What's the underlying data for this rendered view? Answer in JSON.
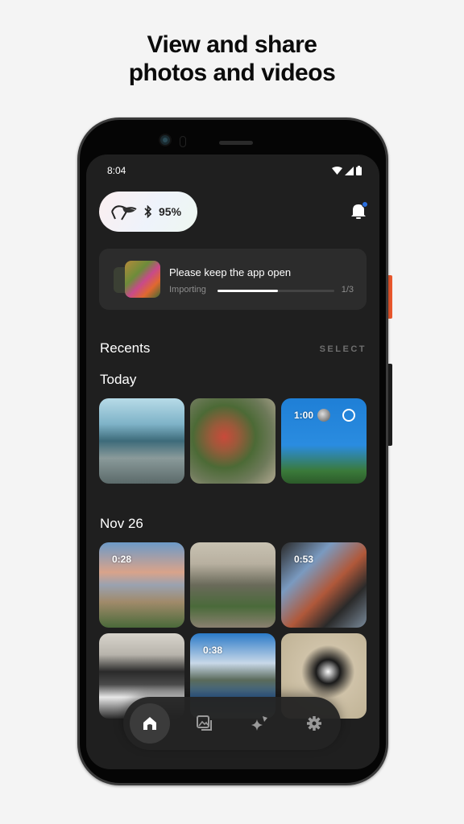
{
  "headline": {
    "line1": "View and share",
    "line2": "photos and videos"
  },
  "status_bar": {
    "time": "8:04",
    "icons": [
      "wifi-icon",
      "signal-icon",
      "battery-icon"
    ]
  },
  "device": {
    "icon": "glasses-icon",
    "connection_icon": "bluetooth-icon",
    "battery": "95%"
  },
  "notifications": {
    "icon": "bell-icon",
    "has_unread": true,
    "dot_color": "#2a6fe0"
  },
  "import": {
    "title": "Please keep the app open",
    "status": "Importing",
    "progress_percent": 52,
    "count": "1/3"
  },
  "recents": {
    "title": "Recents",
    "select_label": "SELECT"
  },
  "sections": [
    {
      "label": "Today",
      "items": [
        {
          "type": "photo",
          "description": "beach with person holding hand"
        },
        {
          "type": "photo",
          "description": "flowers arrangement"
        },
        {
          "type": "video",
          "duration": "1:00",
          "processing": true,
          "description": "hands reaching for ball against sky"
        }
      ]
    },
    {
      "label": "Nov 26",
      "items": [
        {
          "type": "video",
          "duration": "0:28",
          "description": "hot air balloons over landscape"
        },
        {
          "type": "photo",
          "description": "mirror selfie in plant-filled room"
        },
        {
          "type": "video",
          "duration": "0:53",
          "description": "window looking at brick buildings"
        },
        {
          "type": "photo",
          "description": "keyboard synthesizer"
        },
        {
          "type": "video",
          "duration": "0:38",
          "description": "mountain lake hike"
        },
        {
          "type": "photo",
          "description": "black and white dog"
        }
      ]
    }
  ],
  "nav": [
    {
      "name": "home",
      "icon": "home-icon",
      "active": true
    },
    {
      "name": "gallery",
      "icon": "gallery-icon",
      "active": false
    },
    {
      "name": "ai",
      "icon": "sparkle-icon",
      "active": false
    },
    {
      "name": "settings",
      "icon": "gear-icon",
      "active": false
    }
  ],
  "colors": {
    "accent_button": "#e8562c",
    "screen_bg": "#1f1f1f",
    "card_bg": "#2c2c2c"
  }
}
